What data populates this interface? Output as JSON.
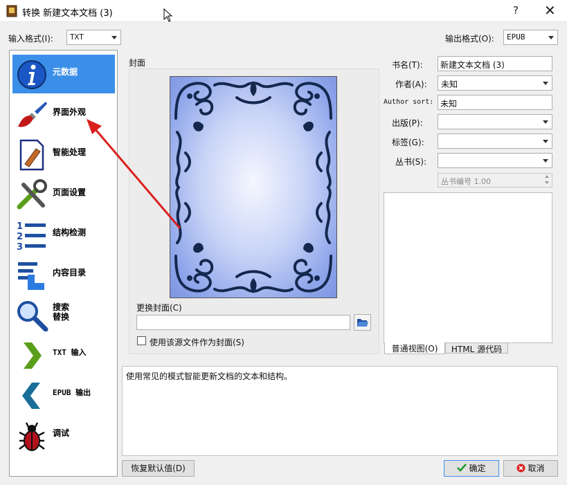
{
  "window": {
    "title": "转换 新建文本文档 (3)",
    "help_glyph": "?",
    "close_glyph": "✕"
  },
  "input_format": {
    "label": "输入格式(I):",
    "value": "TXT"
  },
  "output_format": {
    "label": "输出格式(O):",
    "value": "EPUB"
  },
  "sidebar": {
    "items": [
      {
        "label": "元数据",
        "icon": "info-icon",
        "active": true
      },
      {
        "label": "界面外观",
        "icon": "paintbrush-icon"
      },
      {
        "label": "智能处理",
        "icon": "document-pencil-icon"
      },
      {
        "label": "页面设置",
        "icon": "tools-icon"
      },
      {
        "label": "结构检测",
        "icon": "numbered-list-icon"
      },
      {
        "label": "内容目录",
        "icon": "toc-pointer-icon"
      },
      {
        "label": "搜索\n替换",
        "icon": "magnifier-icon"
      },
      {
        "label": "TXT 输入",
        "icon": "chevron-right-icon"
      },
      {
        "label": "EPUB 输出",
        "icon": "chevron-left-icon"
      },
      {
        "label": "调试",
        "icon": "bug-icon"
      }
    ]
  },
  "cover": {
    "section_label": "封面",
    "change_label": "更换封面(C)",
    "path_value": "",
    "use_source_label": "使用该源文件作为封面(S)",
    "use_source_checked": false
  },
  "metadata": {
    "title_label": "书名(T):",
    "title_value": "新建文本文档 (3)",
    "author_label": "作者(A):",
    "author_value": "未知",
    "author_sort_label": "Author sort:",
    "author_sort_value": "未知",
    "publisher_label": "出版(P):",
    "publisher_value": "",
    "tags_label": "标签(G):",
    "tags_value": "",
    "series_label": "丛书(S):",
    "series_value": "",
    "series_index_value": "丛书编号 1.00"
  },
  "preview_tabs": [
    {
      "label": "普通视图(O)"
    },
    {
      "label": "HTML 源代码"
    }
  ],
  "description": "使用常见的模式智能更新文档的文本和结构。",
  "buttons": {
    "restore_defaults": "恢复默认值(D)",
    "ok": "确定",
    "cancel": "取消"
  },
  "colors": {
    "active_nav": "#3c8fe8",
    "arrow": "#d9201e",
    "cover_ornament": "#14284e"
  }
}
